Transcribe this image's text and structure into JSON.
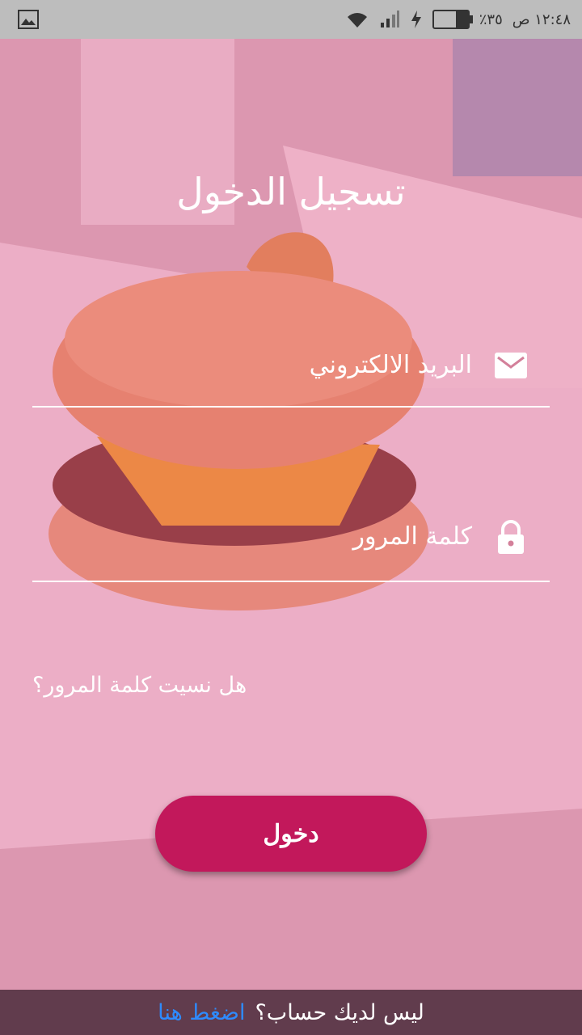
{
  "status_bar": {
    "time": "١٢:٤٨ ص",
    "battery_percent": "٪٣٥",
    "battery_level": 0.35
  },
  "login": {
    "title": "تسجيل الدخول",
    "email_label": "البريد الالكتروني",
    "password_label": "كلمة المرور",
    "forgot_password": "هل نسيت كلمة المرور؟",
    "submit_label": "دخول"
  },
  "footer": {
    "no_account": "ليس لديك حساب؟",
    "link_text": "اضغط هنا"
  },
  "colors": {
    "accent": "#c2185b",
    "link": "#2e8bff",
    "overlay": "#e14682"
  },
  "icons": {
    "email": "envelope-icon",
    "password": "lock-icon",
    "gallery": "image-icon"
  }
}
